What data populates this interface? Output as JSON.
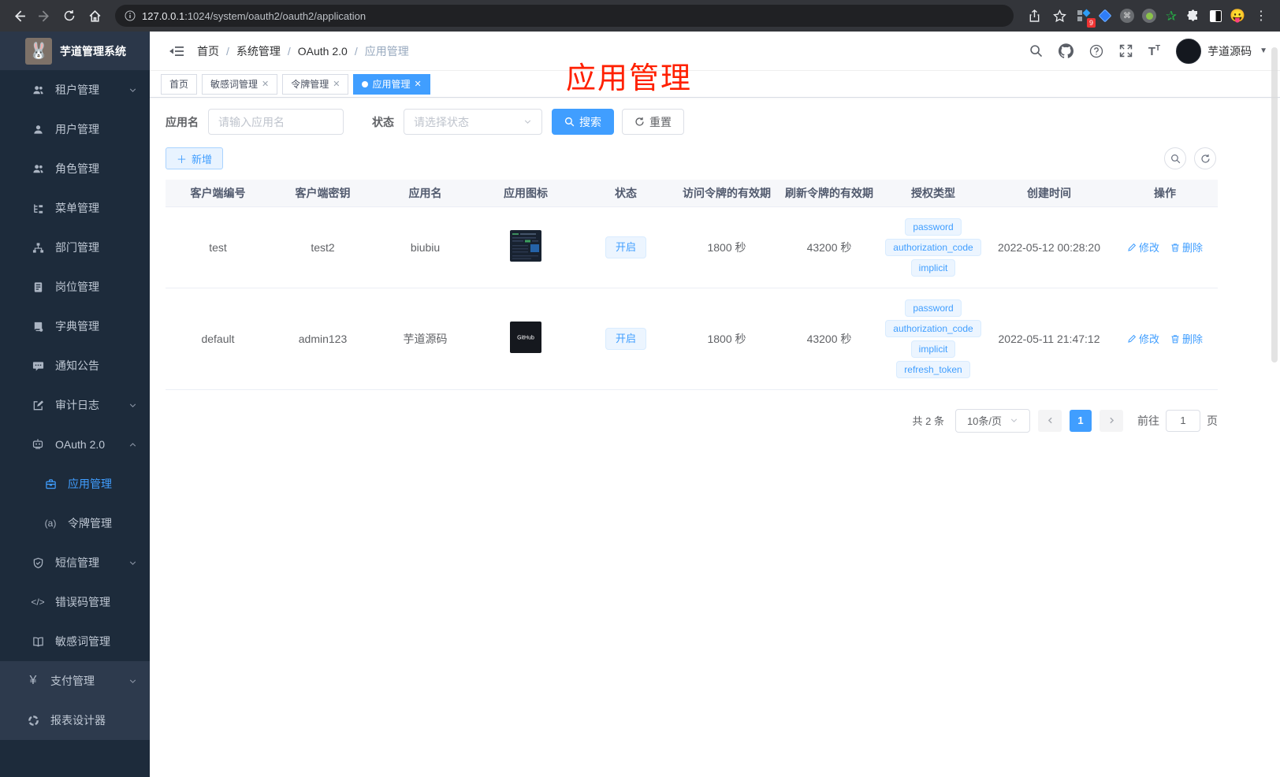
{
  "browser": {
    "url_host": "127.0.0.1",
    "url_rest": ":1024/system/oauth2/oauth2/application",
    "extension_badge": "9"
  },
  "sidebar": {
    "title": "芋道管理系统",
    "items": [
      {
        "label": "租户管理"
      },
      {
        "label": "用户管理"
      },
      {
        "label": "角色管理"
      },
      {
        "label": "菜单管理"
      },
      {
        "label": "部门管理"
      },
      {
        "label": "岗位管理"
      },
      {
        "label": "字典管理"
      },
      {
        "label": "通知公告"
      },
      {
        "label": "审计日志"
      },
      {
        "label": "OAuth 2.0"
      },
      {
        "label": "应用管理"
      },
      {
        "label": "令牌管理"
      },
      {
        "label": "短信管理"
      },
      {
        "label": "错误码管理"
      },
      {
        "label": "敏感词管理"
      },
      {
        "label": "支付管理"
      },
      {
        "label": "报表设计器"
      }
    ]
  },
  "navbar": {
    "breadcrumb": [
      "首页",
      "系统管理",
      "OAuth 2.0",
      "应用管理"
    ],
    "username": "芋道源码"
  },
  "tabs": [
    {
      "label": "首页"
    },
    {
      "label": "敏感词管理"
    },
    {
      "label": "令牌管理"
    },
    {
      "label": "应用管理"
    }
  ],
  "overlay_title": "应用管理",
  "filters": {
    "app_name_label": "应用名",
    "app_name_placeholder": "请输入应用名",
    "status_label": "状态",
    "status_placeholder": "请选择状态",
    "search_label": "搜索",
    "reset_label": "重置",
    "add_label": "新增"
  },
  "table": {
    "columns": [
      "客户端编号",
      "客户端密钥",
      "应用名",
      "应用图标",
      "状态",
      "访问令牌的有效期",
      "刷新令牌的有效期",
      "授权类型",
      "创建时间",
      "操作"
    ],
    "edit_label": "修改",
    "delete_label": "删除",
    "rows": [
      {
        "client_id": "test",
        "client_secret": "test2",
        "app_name": "biubiu",
        "status": "开启",
        "access_token_validity": "1800 秒",
        "refresh_token_validity": "43200 秒",
        "grants": [
          "password",
          "authorization_code",
          "implicit"
        ],
        "created_at": "2022-05-12 00:28:20"
      },
      {
        "client_id": "default",
        "client_secret": "admin123",
        "app_name": "芋道源码",
        "status": "开启",
        "access_token_validity": "1800 秒",
        "refresh_token_validity": "43200 秒",
        "grants": [
          "password",
          "authorization_code",
          "implicit",
          "refresh_token"
        ],
        "created_at": "2022-05-11 21:47:12",
        "icon_label": "GitHub"
      }
    ]
  },
  "pagination": {
    "total": "共 2 条",
    "page_size": "10条/页",
    "current_page": "1",
    "goto_label": "前往",
    "goto_value": "1",
    "unit_label": "页"
  },
  "colors": {
    "accent": "#409eff",
    "overlay_red": "#ff2000"
  }
}
